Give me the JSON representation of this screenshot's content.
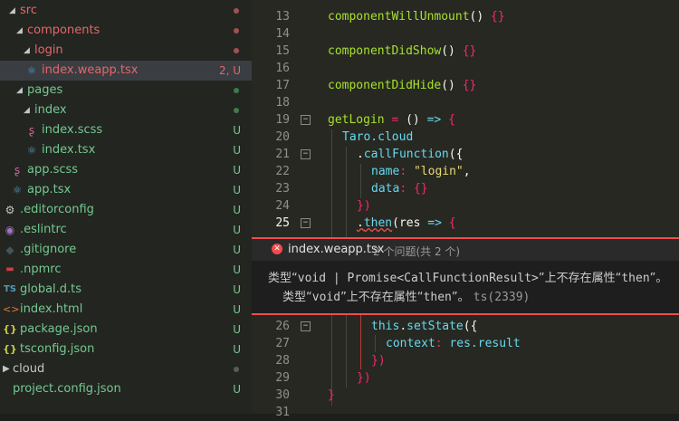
{
  "explorer": {
    "items": [
      {
        "label": "src",
        "status": "dot-red"
      },
      {
        "label": "components",
        "status": "dot-red"
      },
      {
        "label": "login",
        "status": "dot-red"
      },
      {
        "label": "index.weapp.tsx",
        "status": "2, U"
      },
      {
        "label": "pages",
        "status": "dot-green"
      },
      {
        "label": "index",
        "status": "dot-green"
      },
      {
        "label": "index.scss",
        "status": "U"
      },
      {
        "label": "index.tsx",
        "status": "U"
      },
      {
        "label": "app.scss",
        "status": "U"
      },
      {
        "label": "app.tsx",
        "status": "U"
      },
      {
        "label": ".editorconfig",
        "status": "U"
      },
      {
        "label": ".eslintrc",
        "status": "U"
      },
      {
        "label": ".gitignore",
        "status": "U"
      },
      {
        "label": ".npmrc",
        "status": "U"
      },
      {
        "label": "global.d.ts",
        "status": "U"
      },
      {
        "label": "index.html",
        "status": "U"
      },
      {
        "label": "package.json",
        "status": "U"
      },
      {
        "label": "tsconfig.json",
        "status": "U"
      },
      {
        "label": "cloud",
        "status": "dot-gray"
      },
      {
        "label": "project.config.json",
        "status": "U"
      }
    ],
    "icons": {
      "ts": "TS",
      "json": "{}",
      "html": "<>"
    }
  },
  "editor": {
    "lines": {
      "n13": "13",
      "n14": "14",
      "n15": "15",
      "n16": "16",
      "n17": "17",
      "n18": "18",
      "n19": "19",
      "n20": "20",
      "n21": "21",
      "n22": "22",
      "n23": "23",
      "n24": "24",
      "n25": "25",
      "n26": "26",
      "n27": "27",
      "n28": "28",
      "n29": "29",
      "n30": "30",
      "n31": "31"
    },
    "tok": {
      "componentWillUnmount": "componentWillUnmount",
      "componentDidShow": "componentDidShow",
      "componentDidHide": "componentDidHide",
      "parens": "()",
      "braces": "{}",
      "getLogin": "getLogin",
      "eq": " = ",
      "arrow": " => ",
      "open": "{",
      "taro": "Taro.cloud",
      "dot": ".",
      "callFunction": "callFunction",
      "paren_open": "({",
      "name": "name",
      "colon": ": ",
      "login_str": "\"login\"",
      "comma": ",",
      "data": "data",
      "close_paren": "})",
      "then": "then",
      "res": "(res",
      "this": "this",
      "setState": "setState",
      "context": "context",
      "res_result": "res.result",
      "close_brace": "}"
    }
  },
  "peek": {
    "filename": "index.weapp.tsx",
    "count": "2 个问题(共 2 个)",
    "close_glyph": "✕",
    "msg1_a": "类型“",
    "msg1_code": "void | Promise<CallFunctionResult>",
    "msg1_b": "”上不存在属性“",
    "msg1_then": "then",
    "msg1_c": "”。",
    "msg2_a": "类型“",
    "msg2_code": "void",
    "msg2_b": "”上不存在属性“",
    "msg2_then": "then",
    "msg2_c": "”。",
    "msg2_src": "ts(2339)"
  }
}
